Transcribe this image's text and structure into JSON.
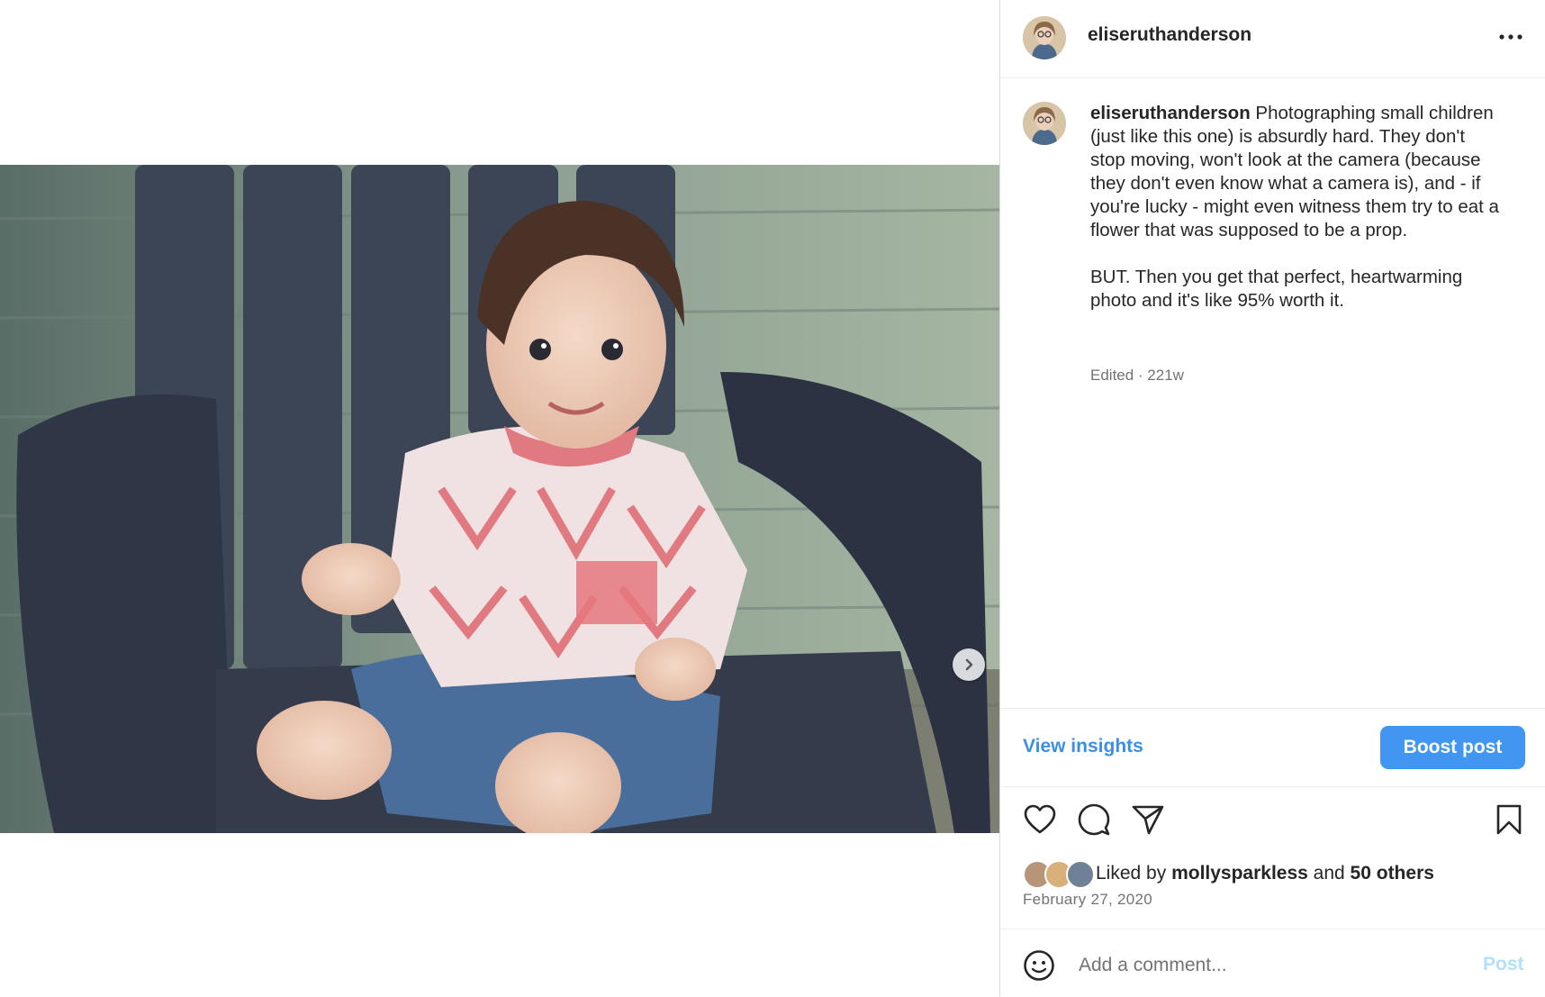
{
  "post": {
    "username": "eliseruthanderson",
    "caption": {
      "username": "eliseruthanderson",
      "text": " Photographing small children (just like this one) is absurdly hard. They don't stop moving, won't look at the camera (because they don't even know what a camera is), and - if you're lucky - might even witness them try to eat a flower that was supposed to be a prop.\n\nBUT. Then you get that perfect, heartwarming photo and it's like 95% worth it.",
      "meta": "Edited · 221w"
    },
    "insights": {
      "view_label": "View insights",
      "boost_label": "Boost post"
    },
    "likes": {
      "prefix": "Liked by ",
      "liked_by_user": "mollysparkless",
      "connector": " and ",
      "others": "50 others"
    },
    "date": "February 27, 2020",
    "comment": {
      "placeholder": "Add a comment...",
      "post_label": "Post"
    }
  },
  "icons": {
    "more": "more-horizontal-icon",
    "next": "chevron-right-icon",
    "like": "heart-icon",
    "comment": "comment-bubble-icon",
    "share": "paper-plane-icon",
    "save": "bookmark-icon",
    "emoji": "emoji-smile-icon"
  },
  "colors": {
    "link_blue": "#3d8fe5",
    "boost_blue": "#4096f0",
    "post_disabled": "#b2dffc",
    "muted": "#737373"
  }
}
